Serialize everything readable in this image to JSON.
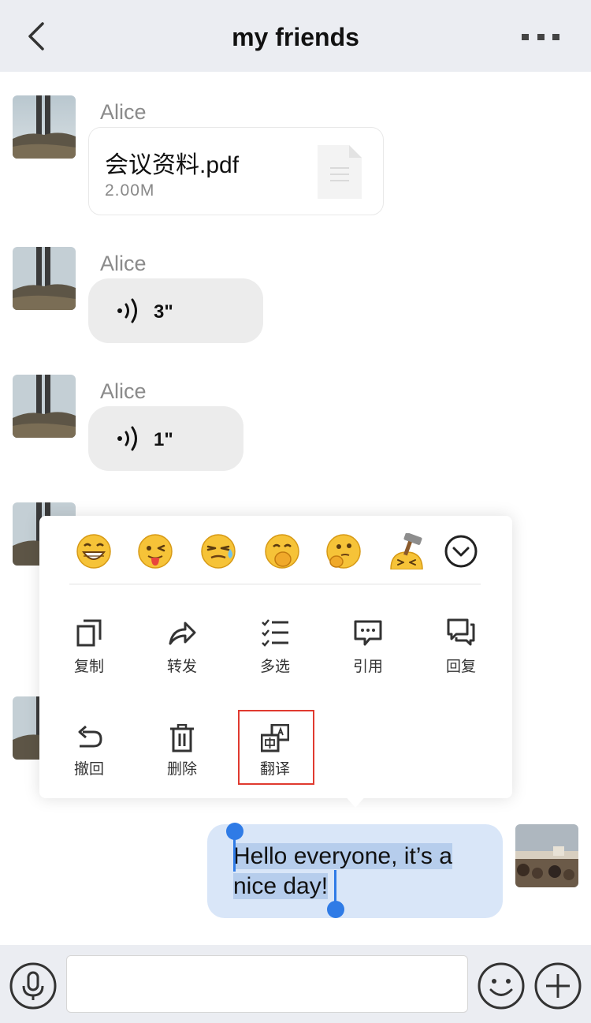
{
  "header": {
    "title": "my friends"
  },
  "messages": [
    {
      "sender": "Alice",
      "file_name": "会议资料.pdf",
      "file_size": "2.00M"
    },
    {
      "sender": "Alice",
      "voice_duration": "3\""
    },
    {
      "sender": "Alice",
      "voice_duration": "1\""
    }
  ],
  "popup": {
    "emojis": [
      "grin-emoji",
      "tongue-wink-emoji",
      "sweat-emoji",
      "snicker-emoji",
      "thinking-emoji",
      "hammer-emoji"
    ],
    "actions_row1": [
      {
        "label": "复制",
        "icon": "copy-icon"
      },
      {
        "label": "转发",
        "icon": "forward-icon"
      },
      {
        "label": "多选",
        "icon": "multi-select-icon"
      },
      {
        "label": "引用",
        "icon": "quote-icon"
      },
      {
        "label": "回复",
        "icon": "reply-icon"
      }
    ],
    "actions_row2": [
      {
        "label": "撤回",
        "icon": "recall-icon"
      },
      {
        "label": "删除",
        "icon": "delete-icon"
      },
      {
        "label": "翻译",
        "icon": "translate-icon",
        "highlighted": true
      }
    ]
  },
  "my_message": {
    "text": "Hello everyone, it’s a nice day!"
  },
  "input": {
    "value": ""
  },
  "colors": {
    "nav_bg": "#ebedf2",
    "my_bubble": "#d9e6f8",
    "selection": "#b6cdec",
    "handle": "#2f7be6",
    "highlight_border": "#e03a2f"
  }
}
